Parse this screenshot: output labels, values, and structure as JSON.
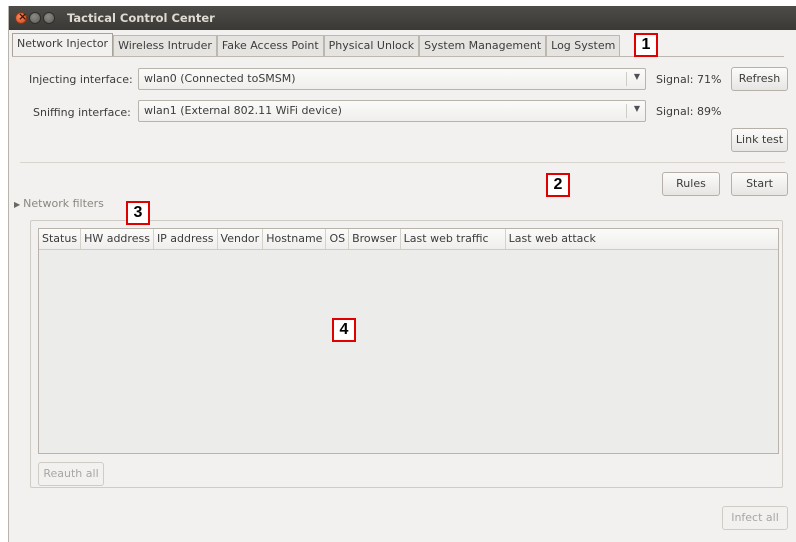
{
  "window": {
    "title": "Tactical Control Center"
  },
  "tabs": [
    {
      "label": "Network Injector"
    },
    {
      "label": "Wireless Intruder"
    },
    {
      "label": "Fake Access Point"
    },
    {
      "label": "Physical Unlock"
    },
    {
      "label": "System Management"
    },
    {
      "label": "Log System"
    }
  ],
  "injecting": {
    "label": "Injecting interface:",
    "value": "wlan0 (Connected toSMSM)",
    "signal": "Signal: 71%"
  },
  "sniffing": {
    "label": "Sniffing interface:",
    "value": "wlan1 (External 802.11 WiFi device)",
    "signal": "Signal: 89%"
  },
  "buttons": {
    "refresh": "Refresh",
    "link_test": "Link test",
    "rules": "Rules",
    "start": "Start",
    "reauth_all": "Reauth all",
    "infect_all": "Infect all"
  },
  "filters": {
    "label": "Network filters"
  },
  "table": {
    "columns": [
      "Status",
      "HW address",
      "IP address",
      "Vendor",
      "Hostname",
      "OS",
      "Browser",
      "Last web traffic",
      "Last web attack"
    ],
    "rows": []
  },
  "markers": [
    "1",
    "2",
    "3",
    "4"
  ],
  "colors": {
    "marker_border": "#e00000",
    "titlebar": "#3c3b37",
    "window_bg": "#f2f1f0"
  },
  "icons": {
    "dropdown": "triangle-down",
    "expander": "triangle-right"
  }
}
